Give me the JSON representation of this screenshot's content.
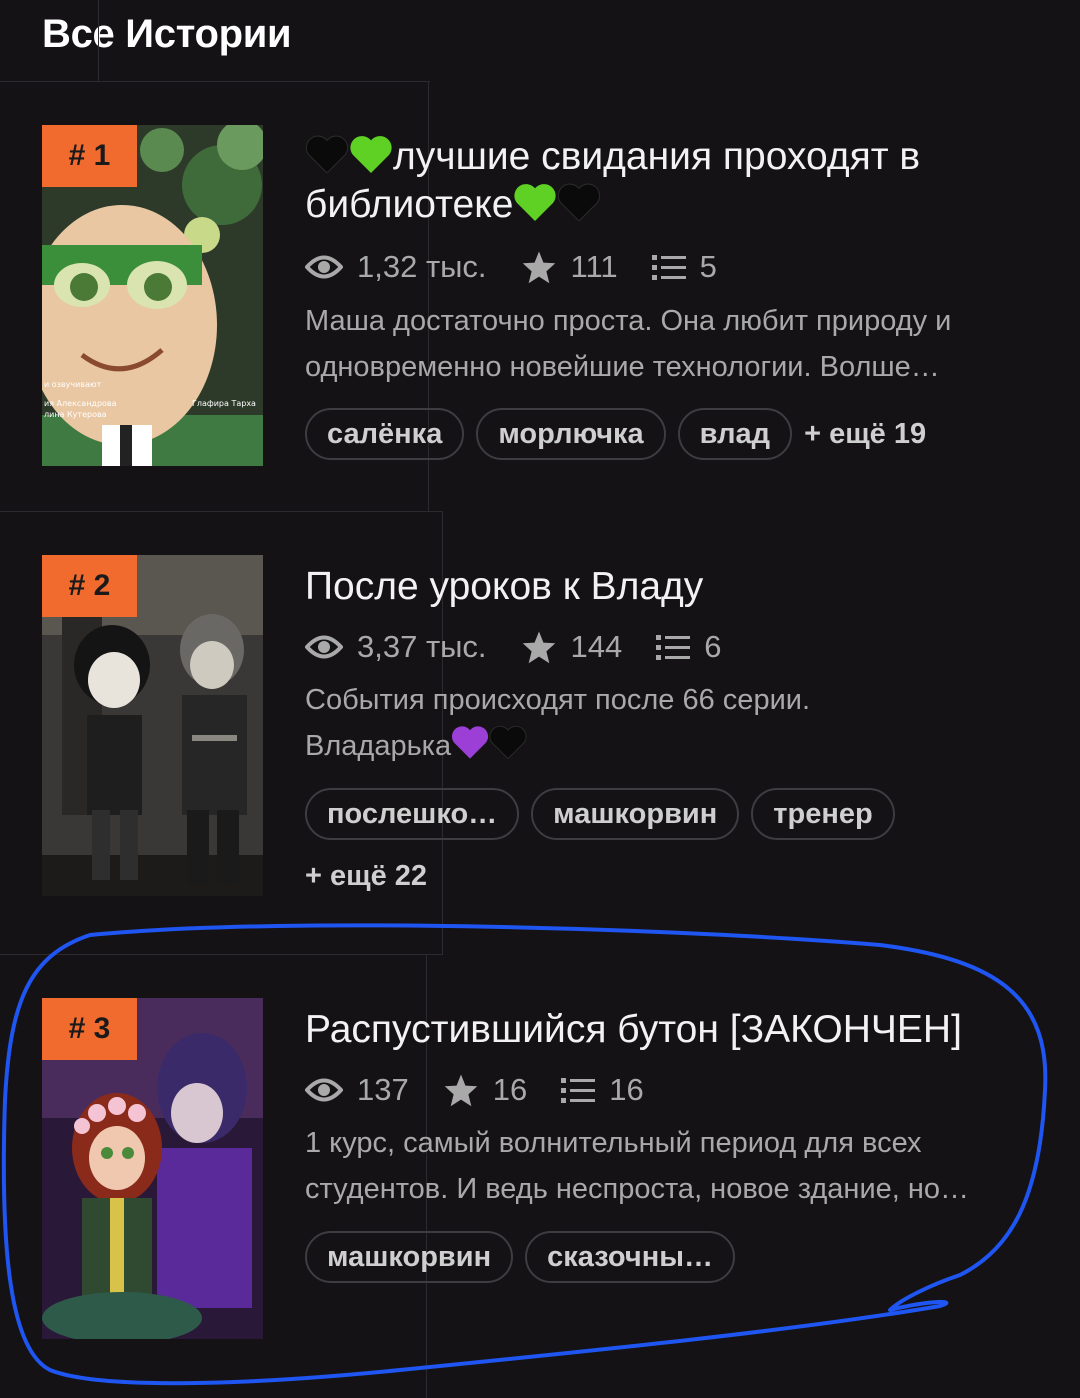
{
  "page": {
    "title": "Все Истории"
  },
  "stories": [
    {
      "rank": "# 1",
      "title_text": "лучшие свидания проходят в библиотеке",
      "views": "1,32 тыс.",
      "likes": "111",
      "chapters": "5",
      "description": "Маша достаточно проста. Она любит природу и одновременно новейшие технологии. Волше…",
      "tags": [
        "салёнка",
        "морлючка",
        "влад"
      ],
      "more_tags": "+ ещё 19",
      "cover_text": [
        "и озвучивают",
        "ия Александрова",
        "лина Кутерова",
        "Глафира Тарха"
      ]
    },
    {
      "rank": "# 2",
      "title": "После уроков к Владу",
      "views": "3,37 тыс.",
      "likes": "144",
      "chapters": "6",
      "description_line1": "События происходят после 66 серии.",
      "description_line2": "Владарька",
      "tags": [
        "послешко…",
        "машкорвин",
        "тренер"
      ],
      "more_tags": "+ ещё 22"
    },
    {
      "rank": "# 3",
      "title": "Распустившийся бутон [ЗАКОНЧЕН]",
      "views": "137",
      "likes": "16",
      "chapters": "16",
      "description": "1 курс, самый волнительный период для всех студентов. И ведь неспроста, новое здание, но…",
      "tags": [
        "машкорвин",
        "сказочны…"
      ]
    }
  ],
  "colors": {
    "background": "#141215",
    "rank_badge": "#f26b2e",
    "highlight_stroke": "#1f55f0",
    "heart_green": "#5ed124",
    "heart_purple": "#9b3fd6",
    "heart_black": "#0a0a0a"
  },
  "icons": [
    "eye-icon",
    "star-icon",
    "list-icon",
    "green-heart-icon",
    "black-heart-icon",
    "purple-heart-icon"
  ]
}
